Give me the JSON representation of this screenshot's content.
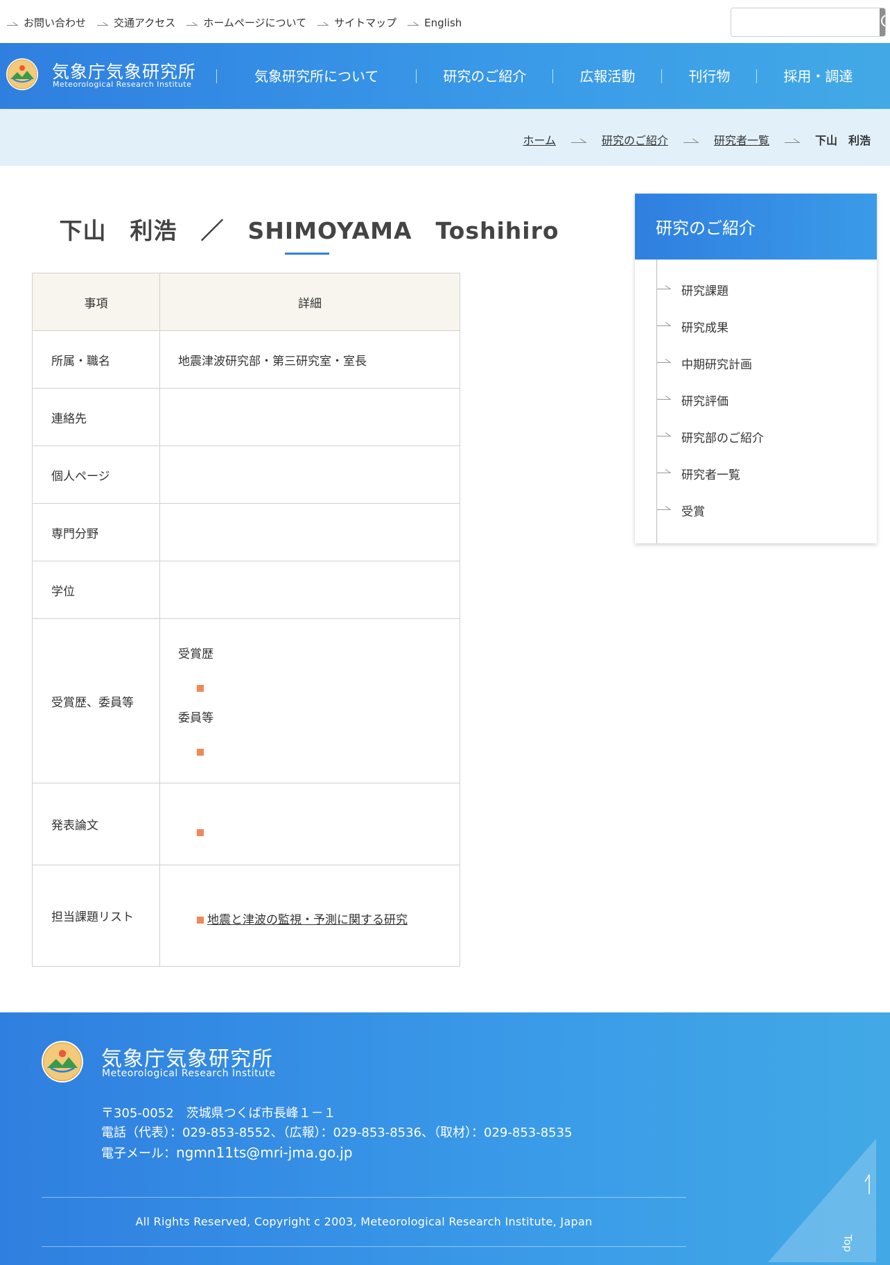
{
  "util": {
    "links": [
      "お問い合わせ",
      "交通アクセス",
      "ホームページについて",
      "サイトマップ",
      "English"
    ],
    "search_placeholder": ""
  },
  "header": {
    "brand_jp": "気象庁気象研究所",
    "brand_en": "Meteorological Research Institute",
    "nav": [
      "気象研究所について",
      "研究のご紹介",
      "広報活動",
      "刊行物",
      "採用・調達"
    ]
  },
  "breadcrumb": {
    "items": [
      "ホーム",
      "研究のご紹介",
      "研究者一覧"
    ],
    "current": "下山　利浩"
  },
  "title": "下山　利浩　／　SHIMOYAMA　Toshihiro",
  "table": {
    "head_item": "事項",
    "head_detail": "詳細",
    "rows": {
      "affiliation": {
        "label": "所属・職名",
        "value": "地震津波研究部・第三研究室・室長"
      },
      "contact": {
        "label": "連絡先",
        "value": ""
      },
      "personal_page": {
        "label": "個人ページ",
        "value": ""
      },
      "specialty": {
        "label": "専門分野",
        "value": ""
      },
      "degree": {
        "label": "学位",
        "value": ""
      },
      "awards": {
        "label": "受賞歴、委員等",
        "awards_heading": "受賞歴",
        "committee_heading": "委員等"
      },
      "papers": {
        "label": "発表論文"
      },
      "tasks": {
        "label": "担当課題リスト",
        "link": "地震と津波の監視・予測に関する研究"
      }
    }
  },
  "sidebar": {
    "title": "研究のご紹介",
    "items": [
      "研究課題",
      "研究成果",
      "中期研究計画",
      "研究評価",
      "研究部のご紹介",
      "研究者一覧",
      "受賞"
    ]
  },
  "footer": {
    "brand_jp": "気象庁気象研究所",
    "brand_en": "Meteorological Research Institute",
    "address": "〒305-0052　茨城県つくば市長峰１－１",
    "phone": "電話（代表）：029-853-8552、（広報）：029-853-8536、（取材）：029-853-8535",
    "mail_label": "電子メール：",
    "mail": "ngmn11ts@mri-jma.go.jp",
    "copyright": "All Rights Reserved, Copyright c 2003, Meteorological Research Institute, Japan",
    "top_label": "Top"
  },
  "colors": {
    "primary": "#2f7fe0",
    "bullet": "#f0885a",
    "crumb_bg": "#e2f0f9"
  }
}
